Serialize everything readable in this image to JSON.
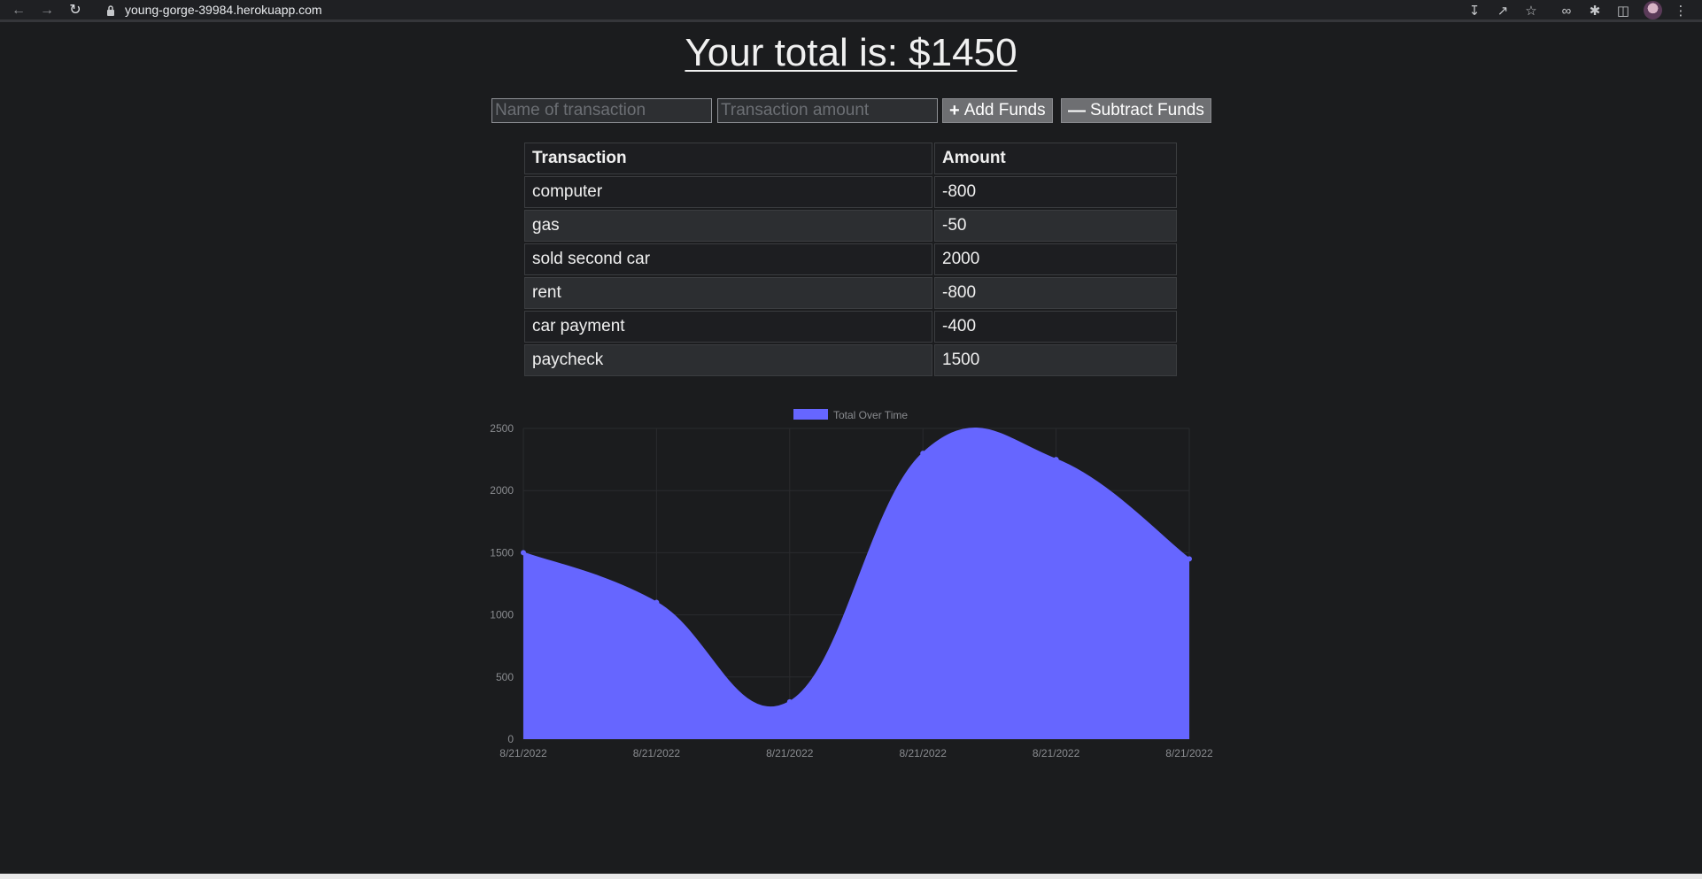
{
  "browser": {
    "url": "young-gorge-39984.herokuapp.com"
  },
  "page": {
    "title": "Your total is: $1450"
  },
  "form": {
    "name_placeholder": "Name of transaction",
    "amount_placeholder": "Transaction amount",
    "add_label": "Add Funds",
    "add_icon": "plus-icon",
    "subtract_label": "Subtract Funds",
    "subtract_icon": "minus-icon"
  },
  "table": {
    "headers": [
      "Transaction",
      "Amount"
    ],
    "rows": [
      {
        "name": "computer",
        "amount": "-800"
      },
      {
        "name": "gas",
        "amount": "-50"
      },
      {
        "name": "sold second car",
        "amount": "2000"
      },
      {
        "name": "rent",
        "amount": "-800"
      },
      {
        "name": "car payment",
        "amount": "-400"
      },
      {
        "name": "paycheck",
        "amount": "1500"
      }
    ]
  },
  "chart_data": {
    "type": "area",
    "title": "",
    "xlabel": "",
    "ylabel": "",
    "x": [
      "8/21/2022",
      "8/21/2022",
      "8/21/2022",
      "8/21/2022",
      "8/21/2022",
      "8/21/2022"
    ],
    "series": [
      {
        "name": "Total Over Time",
        "values": [
          1500,
          1100,
          300,
          2300,
          2250,
          1450
        ],
        "color": "#6666ff"
      }
    ],
    "ylim": [
      0,
      2500
    ],
    "yticks": [
      0,
      500,
      1000,
      1500,
      2000,
      2500
    ],
    "grid": true,
    "legend": "top",
    "curve": "smooth"
  }
}
